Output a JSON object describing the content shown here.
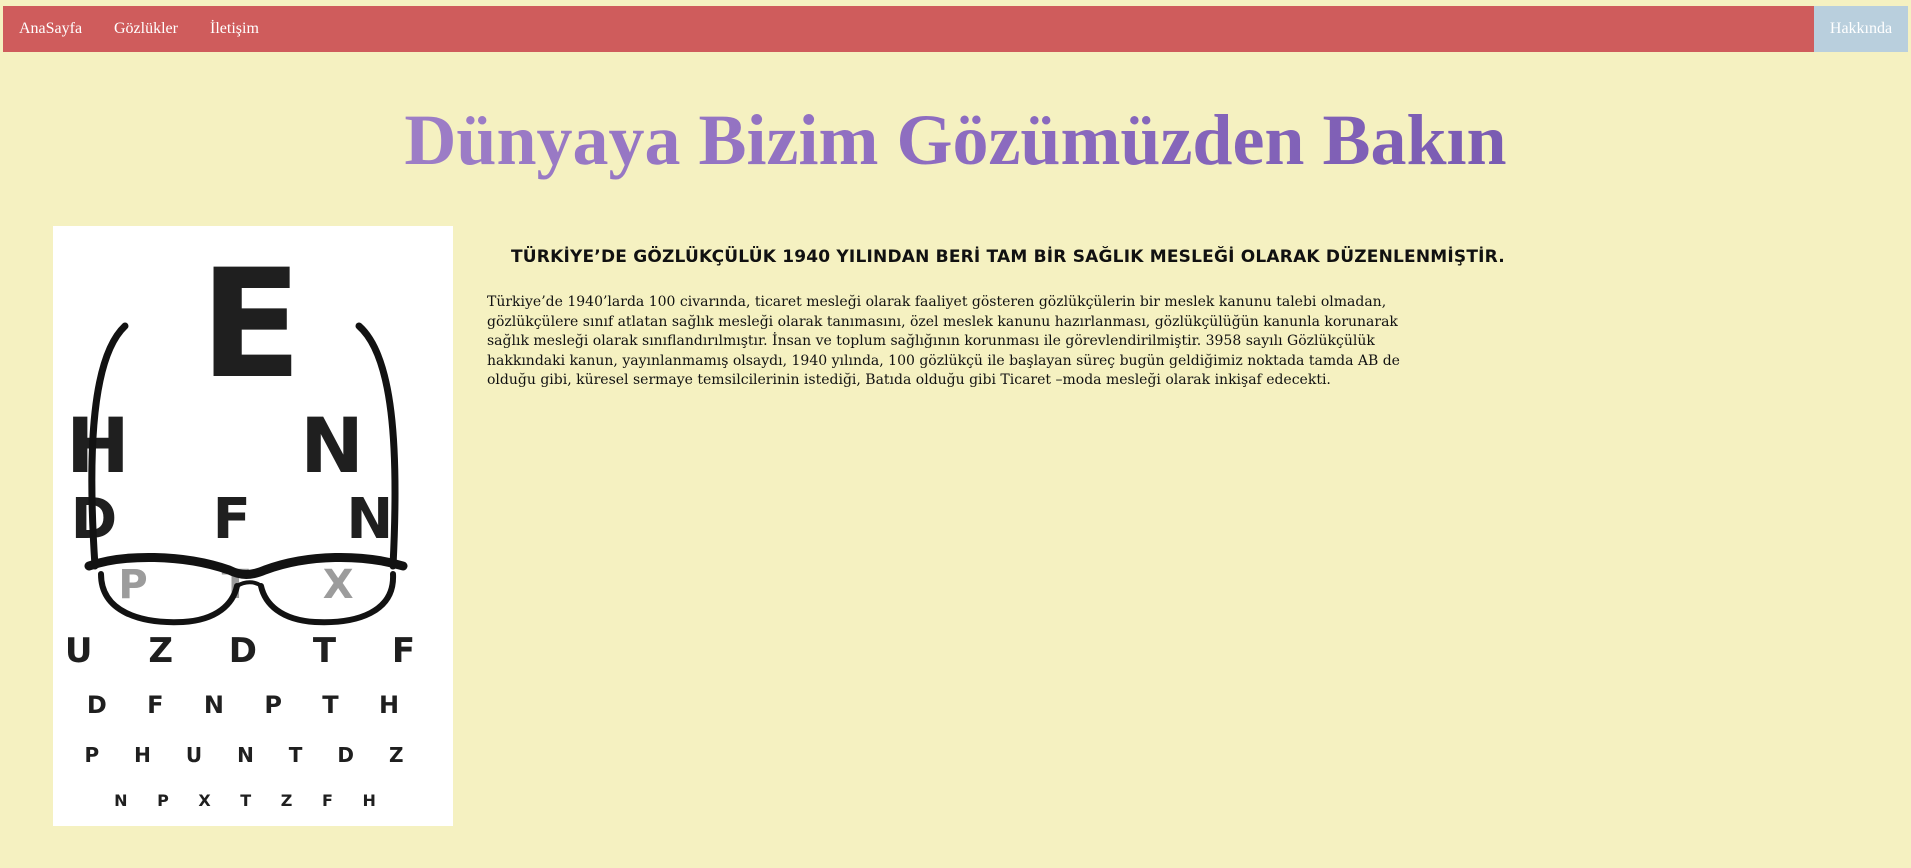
{
  "nav": {
    "home": "AnaSayfa",
    "glasses": "Gözlükler",
    "contact": "İletişim",
    "about": "Hakkında"
  },
  "hero": {
    "title": "Dünyaya Bizim Gözümüzden Bakın"
  },
  "article": {
    "heading": "TÜRKİYE’DE GÖZLÜKÇÜLÜK 1940 YILINDAN BERİ TAM BİR SAĞLIK MESLEĞİ OLARAK DÜZENLENMİŞTİR.",
    "body": "Türkiye’de 1940’larda 100 civarında, ticaret mesleği olarak faaliyet gösteren gözlükçülerin bir meslek kanunu talebi olmadan, gözlükçülere sınıf atlatan sağlık mesleği olarak tanımasını, özel meslek kanunu hazırlanması, gözlükçülüğün kanunla korunarak sağlık mesleği olarak sınıflandırılmıştır. İnsan ve toplum sağlığının korunması ile görevlendirilmiştir. 3958 sayılı Gözlükçülük hakkındaki kanun, yayınlanmamış olsaydı, 1940 yılında, 100 gözlükçü ile başlayan süreç bugün geldiğimiz noktada tamda AB de olduğu gibi, küresel sermaye temsilcilerinin istediği, Batıda olduğu gibi Ticaret –moda mesleği olarak inkişaf edecekti."
  },
  "image": {
    "chart_rows": [
      "E",
      "H N",
      "D F N",
      "P T X",
      "U Z D T F",
      "D F N P T H",
      "P H U N T D Z",
      "N P X T Z F H"
    ]
  },
  "colors": {
    "background": "#f5f1c1",
    "navbar": "#cf5c5c",
    "about_button": "#b9cfdd",
    "title_gradient": [
      "#a98bcb",
      "#6c4fa8"
    ]
  }
}
